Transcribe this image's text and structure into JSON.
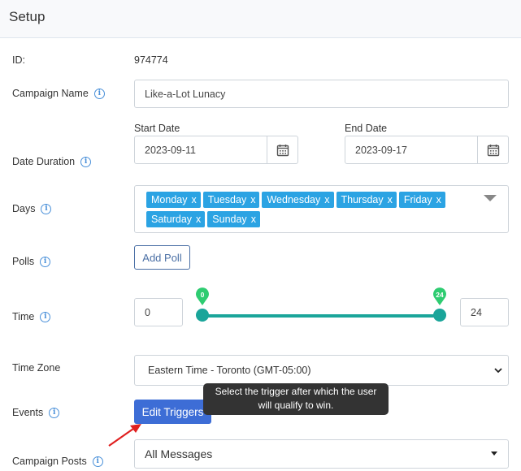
{
  "header": {
    "title": "Setup"
  },
  "fields": {
    "id": {
      "label": "ID:",
      "value": "974774"
    },
    "campaign_name": {
      "label": "Campaign Name",
      "value": "Like-a-Lot Lunacy"
    },
    "date_duration": {
      "label": "Date Duration",
      "start_label": "Start Date",
      "start_value": "2023-09-11",
      "end_label": "End Date",
      "end_value": "2023-09-17"
    },
    "days": {
      "label": "Days",
      "tags": [
        "Monday",
        "Tuesday",
        "Wednesday",
        "Thursday",
        "Friday",
        "Saturday",
        "Sunday"
      ],
      "remove_symbol": "x"
    },
    "polls": {
      "label": "Polls",
      "button": "Add Poll"
    },
    "time": {
      "label": "Time",
      "min_value": "0",
      "max_value": "24",
      "badge_min": "0",
      "badge_max": "24"
    },
    "time_zone": {
      "label": "Time Zone",
      "value": "Eastern Time - Toronto (GMT-05:00)"
    },
    "events": {
      "label": "Events",
      "button": "Edit Triggers",
      "tooltip_line1": "Select the trigger after which the user",
      "tooltip_line2": "will qualify to win."
    },
    "campaign_posts": {
      "label": "Campaign Posts",
      "value": "All Messages"
    }
  },
  "colors": {
    "accent": "#3d6dd6",
    "tag": "#2ba3e3",
    "slider": "#1aa59a",
    "badge": "#2ecc71",
    "annotation": "#e02020"
  },
  "icons": [
    "info-icon",
    "calendar-icon",
    "chevron-down-icon",
    "caret-down-icon",
    "annotation-arrow"
  ]
}
